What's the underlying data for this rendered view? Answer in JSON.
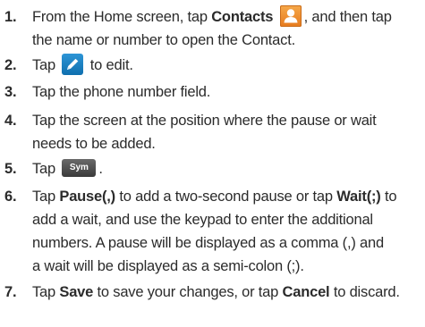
{
  "steps": [
    {
      "number": "1.",
      "before_contacts": "From the Home screen, tap ",
      "contacts_label": "Contacts",
      "after_icon": ", and then tap",
      "line2": "the name or number to open the Contact."
    },
    {
      "number": "2.",
      "before_icon": "Tap ",
      "after_icon": " to edit."
    },
    {
      "number": "3.",
      "text": "Tap the phone number field."
    },
    {
      "number": "4.",
      "line1": "Tap the screen at the position where the pause or wait",
      "line2": "needs to be added."
    },
    {
      "number": "5.",
      "before_icon": "Tap ",
      "sym_label": "Sym",
      "after_icon": "."
    },
    {
      "number": "6.",
      "t1": "Tap ",
      "pause_label": "Pause(,)",
      "t2": " to add a two-second pause or tap ",
      "wait_label": "Wait(;)",
      "t3": " to",
      "line2": "add a wait, and use the keypad to enter the additional",
      "line3": "numbers. A pause will be displayed as a comma (,) and",
      "line4": "a wait will be displayed as a semi-colon (;)."
    },
    {
      "number": "7.",
      "t1": "Tap ",
      "save_label": "Save",
      "t2": " to save your changes, or tap ",
      "cancel_label": "Cancel",
      "t3": " to discard."
    }
  ],
  "icons": {
    "contacts": "contacts-person-icon",
    "edit": "pencil-edit-icon"
  }
}
